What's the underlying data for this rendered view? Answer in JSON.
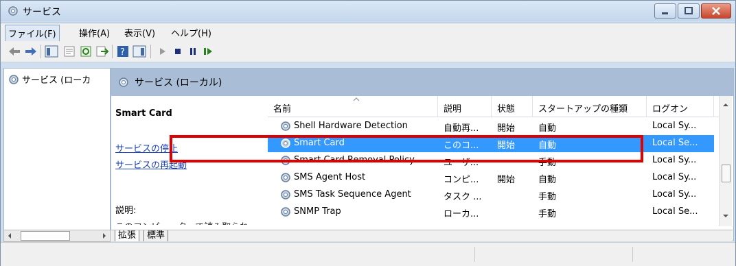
{
  "window": {
    "title": "サービス"
  },
  "menu": [
    {
      "label": "ファイル(F)"
    },
    {
      "label": "操作(A)"
    },
    {
      "label": "表示(V)"
    },
    {
      "label": "ヘルプ(H)"
    }
  ],
  "toolbar": {
    "icons": [
      "back-icon",
      "forward-icon",
      "show-hide-tree-icon",
      "properties-icon",
      "refresh-icon",
      "export-icon",
      "help-icon",
      "show-action-pane-icon",
      "start-service-icon",
      "stop-service-icon",
      "pause-service-icon",
      "resume-service-icon"
    ]
  },
  "tree": {
    "root": "サービス (ローカ"
  },
  "header": {
    "title": "サービス (ローカル)"
  },
  "details": {
    "service_name": "Smart Card",
    "link_stop": "サービスの停止",
    "link_restart": "サービスの再起動",
    "desc_label": "説明:",
    "desc_cut": "このコンピューターで読み取られ"
  },
  "columns": [
    "名前",
    "説明",
    "状態",
    "スタートアップの種類",
    "ログオン"
  ],
  "services": [
    {
      "name": "Shell Hardware Detection",
      "desc": "自動再...",
      "status": "開始",
      "startup": "自動",
      "logon": "Local Sy..."
    },
    {
      "name": "Smart Card",
      "desc": "このコ...",
      "status": "開始",
      "startup": "自動",
      "logon": "Local Se...",
      "selected": true
    },
    {
      "name": "Smart Card Removal Policy",
      "desc": "ユーザ...",
      "status": "",
      "startup": "手動",
      "logon": "Local Sy..."
    },
    {
      "name": "SMS Agent Host",
      "desc": "コンピ...",
      "status": "開始",
      "startup": "自動",
      "logon": "Local Sy..."
    },
    {
      "name": "SMS Task Sequence Agent",
      "desc": "タスク ...",
      "status": "",
      "startup": "手動",
      "logon": "Local Sy..."
    },
    {
      "name": "SNMP Trap",
      "desc": "ローカ...",
      "status": "",
      "startup": "手動",
      "logon": "Local Se..."
    }
  ],
  "tabs": [
    {
      "label": "拡張"
    },
    {
      "label": "標準"
    }
  ],
  "colors": {
    "selection": "#3399ff",
    "highlight": "#e00000",
    "header_band": "#a9bed6"
  }
}
